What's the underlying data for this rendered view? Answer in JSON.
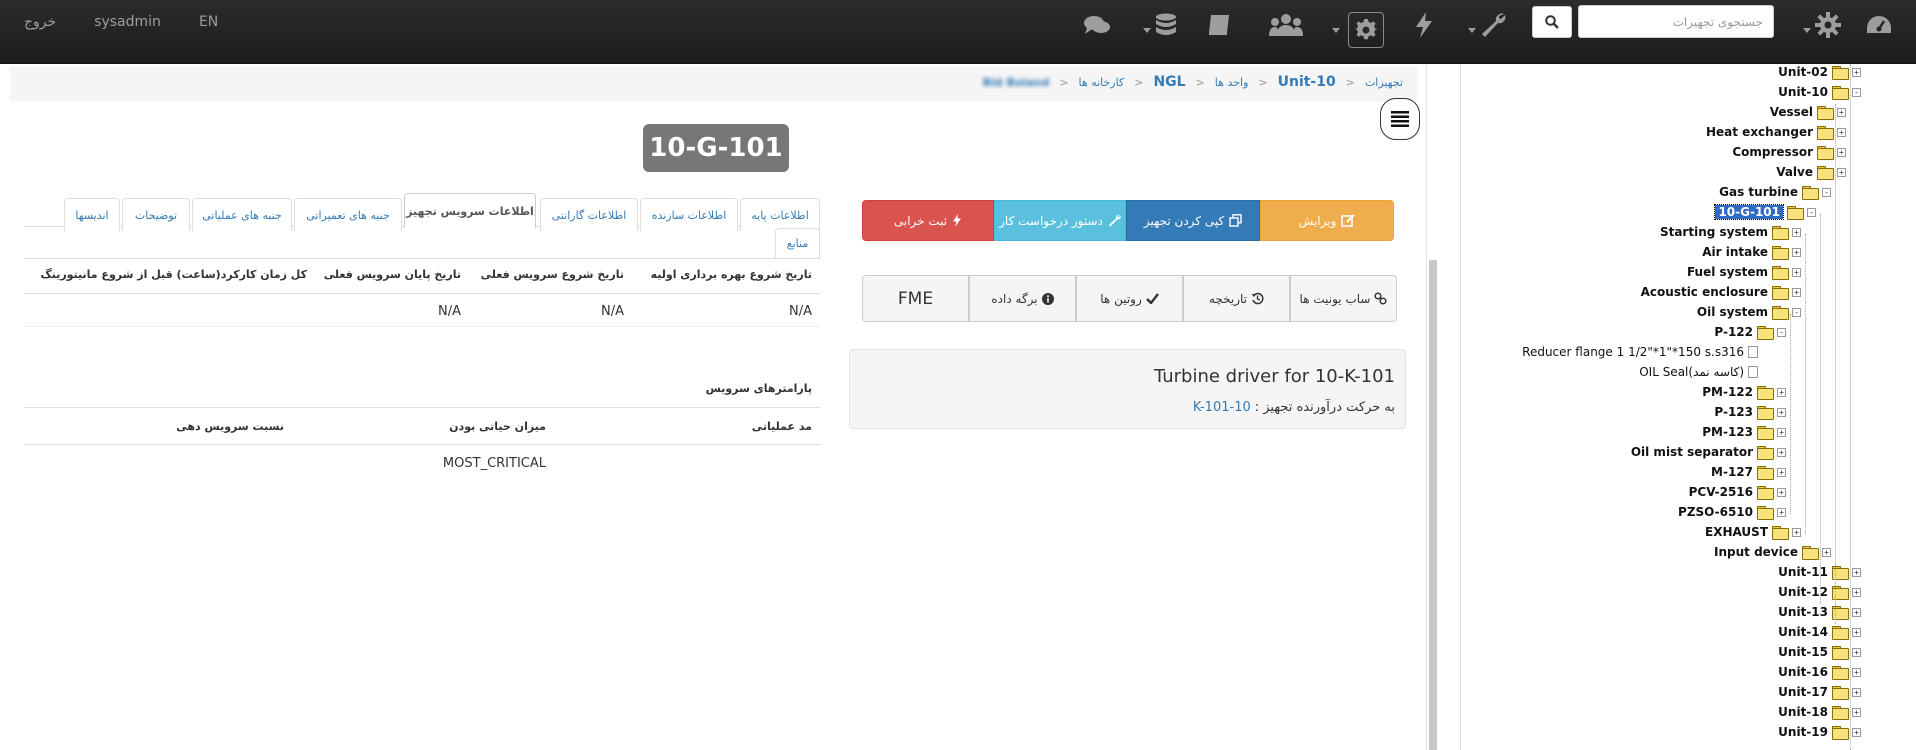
{
  "navbar": {
    "logout": "خروج",
    "user": "sysadmin",
    "lang": "EN",
    "search_placeholder": "جستجوی تجهیزات"
  },
  "breadcrumb": {
    "home": "Bid Boland",
    "factories": "کارخانه ها",
    "site": "NGL",
    "units": "واحد ها",
    "unit": "Unit-10",
    "equipment": "تجهیزات"
  },
  "equipment": {
    "code": "10-G-101",
    "description": "Turbine driver for 10-K-101",
    "driven_label": "به حرکت درآورنده تجهیز :",
    "driven_link": "10-K-101"
  },
  "actions": {
    "edit": "ویرایش",
    "copy": "کپی کردن تجهیز",
    "work_request": "دستور درخواست کار",
    "failure": "ثبت خرابی",
    "sub_units": "ساب یونیت ها",
    "history": "تاریخچه",
    "routines": "روتین ها",
    "datasheet": "برگه داده",
    "fme": "FME"
  },
  "tabs": {
    "basic": "اطلاعات پایه",
    "manufacturer": "اطلاعات سازنده",
    "warranty": "اطلاعات گارانتی",
    "service": "اطلاعات سرویس تجهیز",
    "maintenance": "جنبه های تعمیراتی",
    "operational": "جنبه های عملیاتی",
    "notes": "توضیحات",
    "drawings": "اندیسها",
    "sources": "منابع"
  },
  "service_table": {
    "headers": [
      "تاریخ شروع بهره برداری اولیه",
      "تاریخ شروع سرویس فعلی",
      "تاریخ پایان سرویس فعلی",
      "کل زمان کارکرد(ساعت) قبل از شروع مانیتورینگ"
    ],
    "values": [
      "N/A",
      "N/A",
      "N/A",
      ""
    ]
  },
  "params": {
    "title": "پارامترهای سرویس",
    "headers": [
      "مد عملیاتی",
      "میزان حیاتی بودن",
      "نسبت سرویس دهی"
    ],
    "values": [
      "",
      "MOST_CRITICAL",
      ""
    ]
  },
  "tree": [
    {
      "label": "Unit-02",
      "toggle": "+"
    },
    {
      "label": "Unit-10",
      "toggle": "-"
    },
    {
      "label": "Vessel",
      "toggle": "+"
    },
    {
      "label": "Heat exchanger",
      "toggle": "+"
    },
    {
      "label": "Compressor",
      "toggle": "+"
    },
    {
      "label": "Valve",
      "toggle": "+"
    },
    {
      "label": "Gas turbine",
      "toggle": "-"
    },
    {
      "label": "10-G-101",
      "toggle": "-"
    },
    {
      "label": "Starting system",
      "toggle": "+"
    },
    {
      "label": "Air intake",
      "toggle": "+"
    },
    {
      "label": "Fuel system",
      "toggle": "+"
    },
    {
      "label": "Acoustic enclosure",
      "toggle": "+"
    },
    {
      "label": "Oil system",
      "toggle": "-"
    },
    {
      "label": "P-122",
      "toggle": "-"
    },
    {
      "label": "Reducer flange 1 1/2\"*1\"*150 s.s316",
      "toggle": ""
    },
    {
      "label": "OIL Seal(کاسه نمد)",
      "toggle": ""
    },
    {
      "label": "PM-122",
      "toggle": "+"
    },
    {
      "label": "P-123",
      "toggle": "+"
    },
    {
      "label": "PM-123",
      "toggle": "+"
    },
    {
      "label": "Oil mist separator",
      "toggle": "+"
    },
    {
      "label": "M-127",
      "toggle": "+"
    },
    {
      "label": "PCV-2516",
      "toggle": "+"
    },
    {
      "label": "PZSO-6510",
      "toggle": "+"
    },
    {
      "label": "EXHAUST",
      "toggle": "+"
    },
    {
      "label": "Input device",
      "toggle": "+"
    },
    {
      "label": "Unit-11",
      "toggle": "+"
    },
    {
      "label": "Unit-12",
      "toggle": "+"
    },
    {
      "label": "Unit-13",
      "toggle": "+"
    },
    {
      "label": "Unit-14",
      "toggle": "+"
    },
    {
      "label": "Unit-15",
      "toggle": "+"
    },
    {
      "label": "Unit-16",
      "toggle": "+"
    },
    {
      "label": "Unit-17",
      "toggle": "+"
    },
    {
      "label": "Unit-18",
      "toggle": "+"
    },
    {
      "label": "Unit-19",
      "toggle": "+"
    }
  ],
  "icons": [
    "dashboard-icon",
    "gear-icon",
    "wrench-icon",
    "bolt-icon",
    "cog-box-icon",
    "users-icon",
    "book-icon",
    "database-icon",
    "comments-icon",
    "search-icon",
    "hamburger-icon"
  ],
  "colors": {
    "navbar": "#222222",
    "edit": "#f0ad4e",
    "copy": "#337ab7",
    "work_request": "#5bc0de",
    "failure": "#d9534f",
    "link": "#337ab7"
  }
}
